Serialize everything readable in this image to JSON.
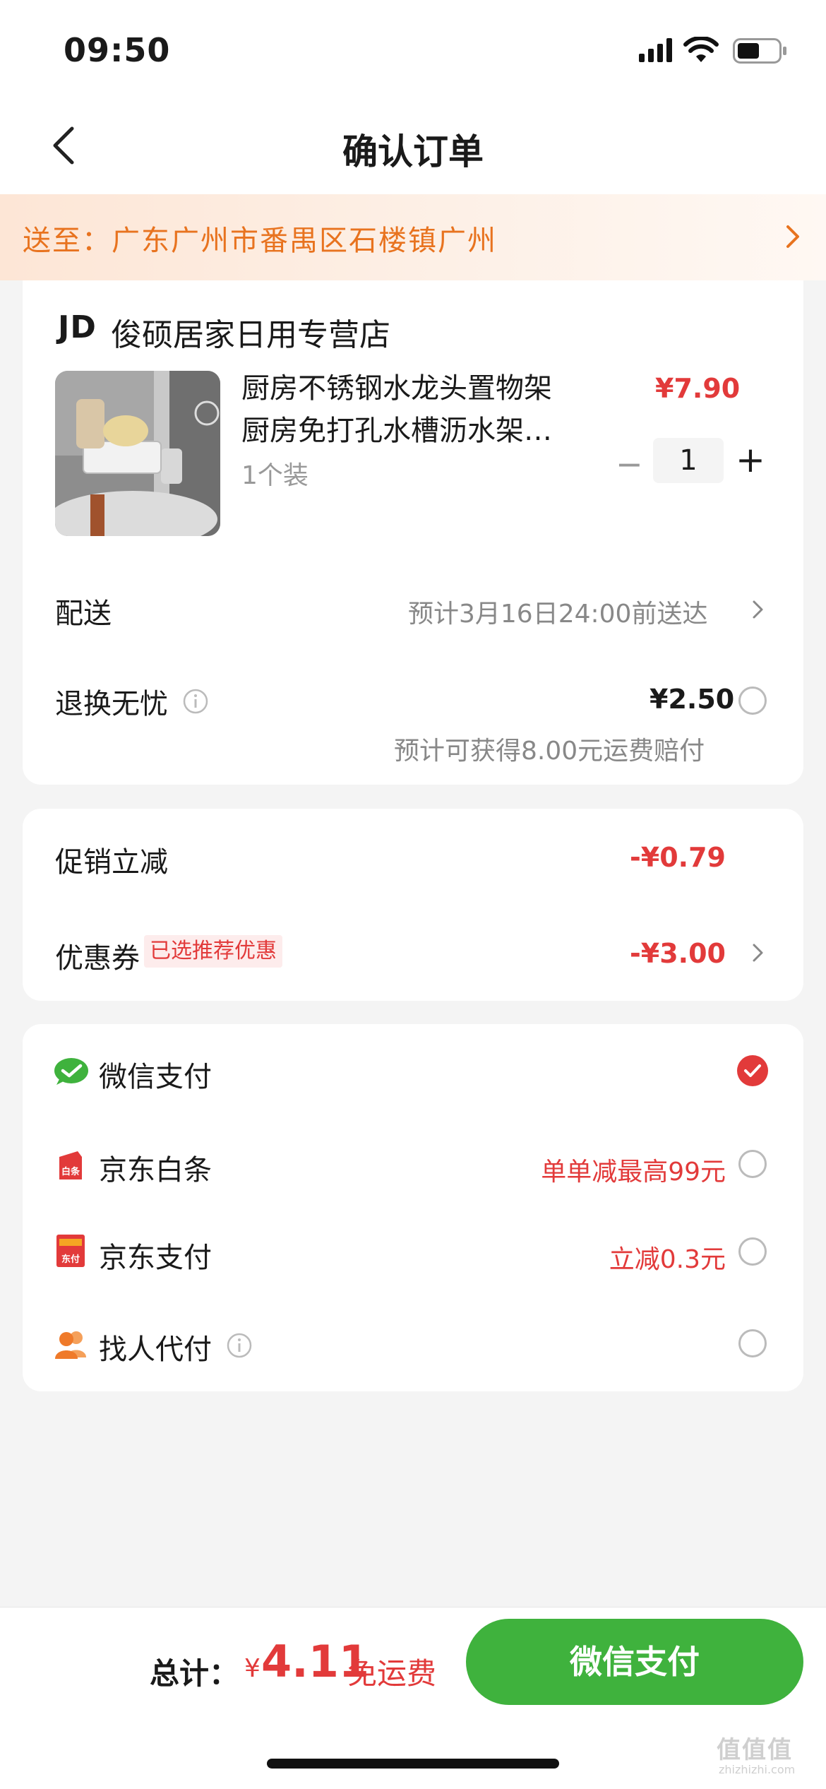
{
  "status": {
    "time": "09:50"
  },
  "nav": {
    "title": "确认订单"
  },
  "address": {
    "text": "送至：广东广州市番禺区石楼镇广州"
  },
  "store": {
    "logo": "JD",
    "name": "俊硕居家日用专营店"
  },
  "product": {
    "name_line1": "厨房不锈钢水龙头置物架",
    "name_line2": "厨房免打孔水槽沥水架…",
    "spec": "1个装",
    "price": "¥7.90",
    "quantity": "1",
    "minus": "−",
    "plus": "+"
  },
  "delivery": {
    "label": "配送",
    "value": "预计3月16日24:00前送达"
  },
  "returns": {
    "label": "退换无忧",
    "price": "¥2.50",
    "note": "预计可获得8.00元运费赔付"
  },
  "promo": {
    "label": "促销立减",
    "value": "-¥0.79",
    "coupon_label": "优惠券",
    "coupon_tag": "已选推荐优惠",
    "coupon_value": "-¥3.00"
  },
  "payment": {
    "options": [
      {
        "label": "微信支付",
        "note": "",
        "selected": true
      },
      {
        "label": "京东白条",
        "note": "单单减最高99元",
        "selected": false
      },
      {
        "label": "京东支付",
        "note": "立减0.3元",
        "selected": false
      },
      {
        "label": "找人代付",
        "note": "",
        "selected": false
      }
    ],
    "baitiao_icon_text": "白条",
    "jdpay_icon_text": "东付"
  },
  "footer": {
    "total_label": "总计：",
    "currency": "¥",
    "total_value": "4.11",
    "free_shipping": "免运费",
    "pay_button": "微信支付"
  },
  "watermark": {
    "text": "值值值",
    "sub": "zhizhizhi.com"
  },
  "colors": {
    "accent": "#e23a3a",
    "wechat_green": "#3fb23d",
    "address_orange": "#e8731f"
  }
}
